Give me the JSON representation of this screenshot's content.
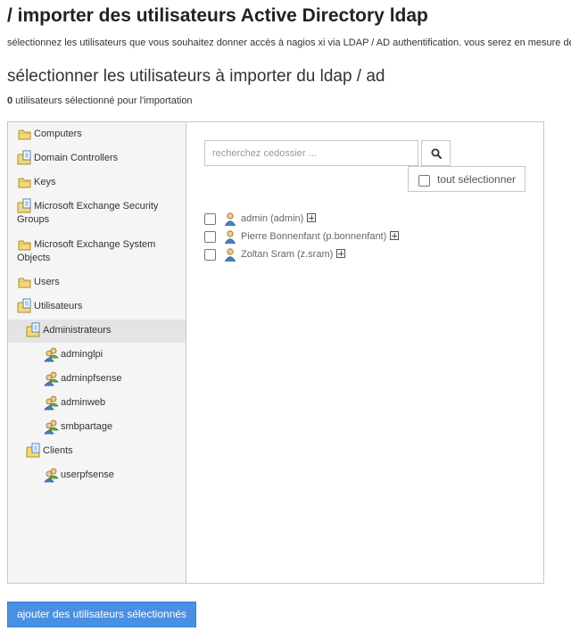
{
  "page": {
    "title": "/ importer des utilisateurs Active Directory ldap",
    "description": "sélectionnez les utilisateurs que vous souhaitez donner accès à nagios xi via LDAP / AD authentification. vous serez en mesure de",
    "subtitle": "sélectionner les utilisateurs à importer du ldap / ad",
    "selected_count": "0",
    "selected_suffix": " utilisateurs sélectionné pour l'importation"
  },
  "tree": {
    "nodes": [
      {
        "label": "Computers",
        "icon": "folder-icon"
      },
      {
        "label": "Domain Controllers",
        "icon": "folder-document-icon"
      },
      {
        "label": "Keys",
        "icon": "folder-icon"
      },
      {
        "label": "Microsoft Exchange Security Groups",
        "icon": "folder-document-icon"
      },
      {
        "label": "Microsoft Exchange System Objects",
        "icon": "folder-icon"
      },
      {
        "label": "Users",
        "icon": "folder-icon"
      },
      {
        "label": "Utilisateurs",
        "icon": "folder-document-icon"
      },
      {
        "label": "Administrateurs",
        "icon": "folder-document-icon",
        "selected": true
      },
      {
        "label": "adminglpi",
        "icon": "user-group-icon"
      },
      {
        "label": "adminpfsense",
        "icon": "user-group-icon"
      },
      {
        "label": "adminweb",
        "icon": "user-group-icon"
      },
      {
        "label": "smbpartage",
        "icon": "user-group-icon"
      },
      {
        "label": "Clients",
        "icon": "folder-document-icon"
      },
      {
        "label": "userpfsense",
        "icon": "user-group-icon"
      }
    ]
  },
  "search": {
    "placeholder": "recherchez cedossier ...",
    "value": ""
  },
  "select_all_label": "tout sélectionner",
  "users": [
    {
      "label": "admin (admin)",
      "checked": false
    },
    {
      "label": "Pierre Bonnenfant (p.bonnenfant)",
      "checked": false
    },
    {
      "label": "Zoltan Sram (z.sram)",
      "checked": false
    }
  ],
  "add_button_label": "ajouter des utilisateurs sélectionnés",
  "colors": {
    "primary_button": "#4a90e2",
    "tree_background": "#f5f5f5",
    "selected_node": "#e4e4e4",
    "folder": "#f5d77a",
    "user_icon": "#4a7fc1"
  }
}
